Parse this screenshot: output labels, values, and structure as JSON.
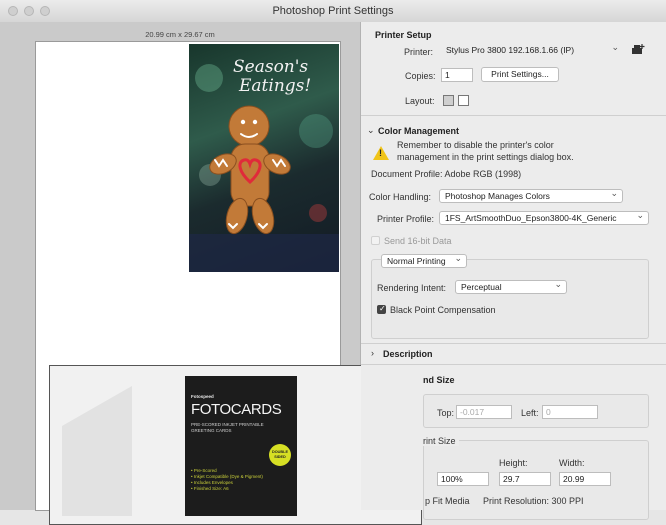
{
  "window": {
    "title": "Photoshop Print Settings"
  },
  "preview": {
    "paper_size": "20.99 cm x 29.67 cm",
    "photo_text": [
      "Season's",
      "Eatings!"
    ],
    "overlay": {
      "brand": "Fotospeed",
      "product": "FOTOCARDS",
      "subtitle": "PRE-SCORED INKJET PRINTABLE GREETING CARDS",
      "badge": "DOUBLE SIDED",
      "features": [
        "• Pre-Scored",
        "• Inkjet Compatible (Dye & Pigment)",
        "• Includes Envelopes",
        "• Finished Size: A6"
      ]
    }
  },
  "printer_setup": {
    "heading": "Printer Setup",
    "printer_label": "Printer:",
    "printer_value": "Stylus Pro 3800 192.168.1.66 (IP)",
    "copies_label": "Copies:",
    "copies_value": "1",
    "print_settings_button": "Print Settings...",
    "layout_label": "Layout:"
  },
  "color_management": {
    "heading": "Color Management",
    "warning": [
      "Remember to disable the printer's color",
      "management in the print settings dialog box."
    ],
    "document_profile": "Document Profile: Adobe RGB (1998)",
    "handling_label": "Color Handling:",
    "handling_value": "Photoshop Manages Colors",
    "profile_label": "Printer Profile:",
    "profile_value": "1FS_ArtSmoothDuo_Epson3800-4K_Generic",
    "send16": "Send 16-bit Data",
    "normal_printing": "Normal Printing",
    "intent_label": "Rendering Intent:",
    "intent_value": "Perceptual",
    "bpc_label": "Black Point Compensation"
  },
  "description": {
    "heading": "Description"
  },
  "position": {
    "heading_partial": "nd Size",
    "top_label": "Top:",
    "top_value": "-0.017",
    "left_label": "Left:",
    "left_value": "0"
  },
  "print_size": {
    "heading_partial": "rint Size",
    "scale_value": "100%",
    "height_label": "Height:",
    "height_value": "29.7",
    "width_label": "Width:",
    "width_value": "20.99",
    "fit_partial": "p Fit Media",
    "resolution": "Print Resolution: 300 PPI"
  },
  "colors": {
    "panel_bg": "#ececec",
    "preview_bg": "#cacaca",
    "warning": "#f0c418",
    "badge": "#d6df24",
    "heart": "#e02a3a",
    "cookie": "#c27a38"
  }
}
